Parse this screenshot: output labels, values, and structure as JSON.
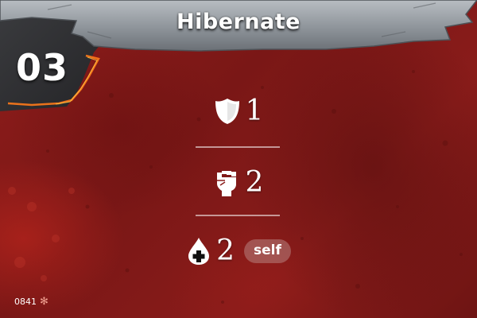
{
  "card": {
    "title": "Hibernate",
    "number": "03",
    "footer_code": "0841",
    "colors": {
      "background": "#8a1c1a",
      "banner": "#9aa0a6",
      "corner_panel": "#2f3033",
      "ember": "#ff7a1a"
    }
  },
  "stats": {
    "shield": {
      "icon": "shield-icon",
      "value": "1"
    },
    "attack": {
      "icon": "fist-icon",
      "value": "2"
    },
    "heal": {
      "icon": "heal-drop-icon",
      "value": "2",
      "tag": "self"
    }
  },
  "footer": {
    "set_icon": "snowflake-icon"
  }
}
